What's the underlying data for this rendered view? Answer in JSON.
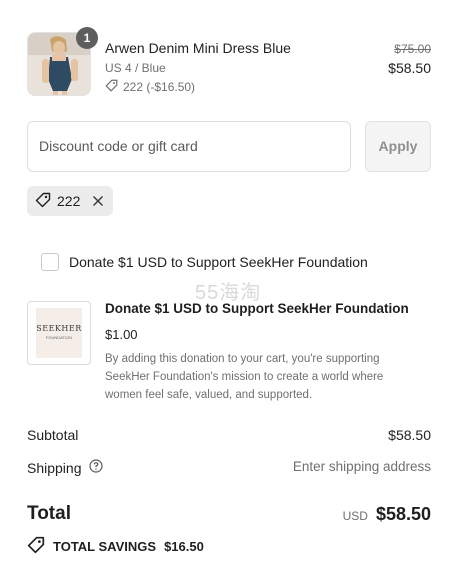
{
  "line_item": {
    "name": "Arwen Denim Mini Dress Blue",
    "variant": "US 4 / Blue",
    "discount": "222 (-$16.50)",
    "quantity": "1",
    "compare_price": "$75.00",
    "price": "$58.50"
  },
  "discount_form": {
    "placeholder": "Discount code or gift card",
    "apply_label": "Apply",
    "applied_code": "222"
  },
  "donation_option": {
    "checkbox_label": "Donate $1 USD to Support SeekHer Foundation",
    "checked": false
  },
  "watermark": "55海淘",
  "donation_item": {
    "logo_text": "SEEKHER",
    "logo_subtext": "FOUNDATION",
    "title": "Donate $1 USD to Support SeekHer Foundation",
    "price": "$1.00",
    "description": "By adding this donation to your cart, you're supporting SeekHer Foundation's mission to create a world where women feel safe, valued, and supported."
  },
  "summary": {
    "subtotal_label": "Subtotal",
    "subtotal_value": "$58.50",
    "shipping_label": "Shipping",
    "shipping_value": "Enter shipping address",
    "total_label": "Total",
    "total_currency": "USD",
    "total_value": "$58.50",
    "savings_label": "TOTAL SAVINGS",
    "savings_value": "$16.50"
  },
  "icons": {
    "tag": "tag-icon",
    "close": "close-icon",
    "help": "help-circle-icon"
  }
}
